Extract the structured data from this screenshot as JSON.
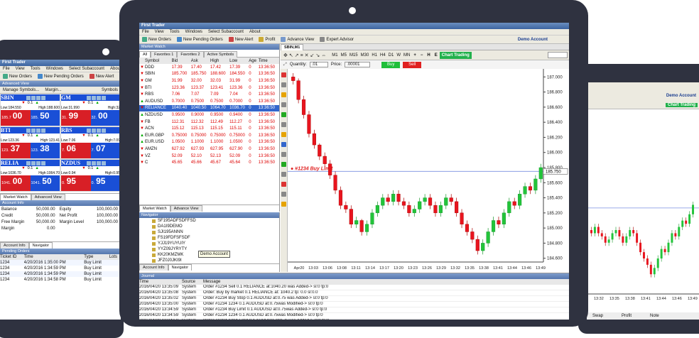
{
  "app": {
    "title": "First Trader",
    "menu": [
      "File",
      "View",
      "Tools",
      "Windows",
      "Select Subaccount",
      "About"
    ],
    "toolbar": {
      "new_orders": "New Orders",
      "new_pending_orders": "New Pending Orders",
      "new_alert": "New Alert",
      "profit": "Profit",
      "advance_view": "Advance View",
      "expert_advisor": "Expert Advisor"
    },
    "account_label": "Demo Account"
  },
  "market_watch": {
    "header": "Market Watch",
    "tabs": [
      "All",
      "Favorites 1",
      "Favorites 2",
      "Active Symbols"
    ],
    "columns": [
      "Symbol",
      "Bid",
      "Ask",
      "High",
      "Low",
      "Age",
      "Time"
    ],
    "rows": [
      {
        "dir": "down",
        "symbol": "DDD",
        "bid": "17.39",
        "ask": "17.40",
        "high": "17.42",
        "low": "17.39",
        "age": "0",
        "time": "13:36:50"
      },
      {
        "dir": "down",
        "symbol": "SBIN",
        "bid": "185.700",
        "ask": "185.750",
        "high": "188.600",
        "low": "184.550",
        "age": "0",
        "time": "13:36:50"
      },
      {
        "dir": "down",
        "symbol": "GM",
        "bid": "31.99",
        "ask": "32.00",
        "high": "32.03",
        "low": "31.99",
        "age": "0",
        "time": "13:36:50"
      },
      {
        "dir": "down",
        "symbol": "BTI",
        "bid": "123.36",
        "ask": "123.37",
        "high": "123.41",
        "low": "123.36",
        "age": "0",
        "time": "13:36:50"
      },
      {
        "dir": "down",
        "symbol": "RBS",
        "bid": "7.06",
        "ask": "7.07",
        "high": "7.09",
        "low": "7.04",
        "age": "0",
        "time": "13:36:50"
      },
      {
        "dir": "up",
        "symbol": "AUDUSD",
        "bid": "0.7000",
        "ask": "0.7500",
        "high": "0.7500",
        "low": "0.7000",
        "age": "0",
        "time": "13:36:50"
      },
      {
        "dir": "down",
        "symbol": "RELIANCE",
        "bid": "1040.40",
        "ask": "1040.50",
        "high": "1064.70",
        "low": "1036.70",
        "age": "0",
        "time": "13:36:50"
      },
      {
        "dir": "up",
        "symbol": "NZDUSD",
        "bid": "0.9500",
        "ask": "0.9000",
        "high": "0.9500",
        "low": "0.9400",
        "age": "0",
        "time": "13:36:50"
      },
      {
        "dir": "down",
        "symbol": "FB",
        "bid": "112.31",
        "ask": "112.32",
        "high": "112.49",
        "low": "112.27",
        "age": "0",
        "time": "13:36:50"
      },
      {
        "dir": "down",
        "symbol": "ACN",
        "bid": "115.12",
        "ask": "115.13",
        "high": "115.15",
        "low": "115.11",
        "age": "0",
        "time": "13:36:50"
      },
      {
        "dir": "up",
        "symbol": "EUR.GBP",
        "bid": "0.75000",
        "ask": "0.75000",
        "high": "0.75000",
        "low": "0.75000",
        "age": "0",
        "time": "13:36:50"
      },
      {
        "dir": "up",
        "symbol": "EUR.USD",
        "bid": "1.0500",
        "ask": "1.1000",
        "high": "1.1000",
        "low": "1.0500",
        "age": "0",
        "time": "13:36:50"
      },
      {
        "dir": "down",
        "symbol": "AMZN",
        "bid": "627.92",
        "ask": "627.93",
        "high": "627.95",
        "low": "627.90",
        "age": "0",
        "time": "13:36:50"
      },
      {
        "dir": "down",
        "symbol": "VZ",
        "bid": "52.09",
        "ask": "52.10",
        "high": "52.13",
        "low": "52.09",
        "age": "0",
        "time": "13:36:50"
      },
      {
        "dir": "down",
        "symbol": "C",
        "bid": "45.65",
        "ask": "45.66",
        "high": "45.67",
        "low": "45.64",
        "age": "0",
        "time": "13:36:50"
      }
    ],
    "bottom_tabs": [
      "Market Watch",
      "Advance View"
    ]
  },
  "navigator": {
    "header": "Navigator",
    "items": [
      "SF195ADFSDFFSD",
      "DA1I9DEMO",
      "SJI195ANNN",
      "FS19FDFSFSDF",
      "YJJ19YUYUIY",
      "YYZ09JYRYTY",
      "KK20KMZMK",
      "JFZ0J0JKI9I"
    ],
    "tooltip": "Demo Account",
    "tabs": [
      "Account Info",
      "Navigator"
    ]
  },
  "chart": {
    "tab": "SBIN,M1",
    "timeframes": [
      "M1",
      "M5",
      "M15",
      "M30",
      "H1",
      "H4",
      "D1",
      "W",
      "MN"
    ],
    "zoom": [
      "+",
      "−",
      "H",
      "E"
    ],
    "chart_trading": "Chart Trading",
    "quantity_label": "Quantity:",
    "quantity_value": ".01",
    "price_label": "Price:",
    "price_value": ".00001",
    "buy": "Buy",
    "sell": "Sell",
    "order_label": "#1234 Buy Limit",
    "price_tag": "185.750"
  },
  "journal": {
    "header": "Journal",
    "columns": [
      "Time",
      "Source",
      "Message"
    ],
    "rows": [
      {
        "time": "2016/04/20 13:35:09",
        "source": "System",
        "message": "Order #1234 Sell 0.1 RELIANCE at:1040.20 was Added-> sl:0 tp:0"
      },
      {
        "time": "2016/04/20 13:35:08",
        "source": "System",
        "message": "Order: Buy by market 0.1 RELIANCE at: 1040.2 tp: 0.0 sl:0.0"
      },
      {
        "time": "2016/04/20 13:35:02",
        "source": "System",
        "message": "Order #1234 Buy Stop 0.1 AUDUSD at:0.75 was Added-> sl:0 tp:0"
      },
      {
        "time": "2016/04/20 13:35:00",
        "source": "System",
        "message": "Order #1234 1234 0.1 AUDUSD at:0.75was Modified-> sl:0 tp:0"
      },
      {
        "time": "2016/04/20 13:34:59",
        "source": "System",
        "message": "Order #1234 Buy Limit 0.1 AUDUSD at:0.75was Added-> sl:0 tp:0"
      },
      {
        "time": "2016/04/20 13:34:59",
        "source": "System",
        "message": "Order #1234 1234 0.1 AUDUSD at:0.75was Modified-> sl:0 tp:0"
      },
      {
        "time": "2016/04/20 13:34:58",
        "source": "System",
        "message": "Order #1234 1234 Limit 0.1 AUDUSD at:0.75was Added-> sl:0 tp:0"
      },
      {
        "time": "2016/04/20 13:34:56",
        "source": "System",
        "message": "Order #1234 1234 0.1 AUDUSD at:0.75was Modified-> sl:0 tp:0"
      }
    ]
  },
  "left_app": {
    "advanced_view": "Advanced View",
    "manage_symbols": "Manage Symbols...",
    "margin": "Margin...",
    "symbols": "Symbols",
    "tiles": [
      {
        "symbol": "SBIN",
        "low": "Low:184.550",
        "high": "High:188.600",
        "qty": "0.1",
        "sell_price": "185.7",
        "sell_big": "00",
        "buy_price": "185.",
        "buy_big": "50",
        "color": "#1a4fd6"
      },
      {
        "symbol": "GM",
        "low": "Low:31.990",
        "high": "High:32",
        "qty": "0.1",
        "sell_price": "31.",
        "sell_big": "99",
        "buy_price": "32.",
        "buy_big": "00",
        "color": "#1a4fd6"
      },
      {
        "symbol": "BTI",
        "low": "Low:123.36",
        "high": "High:123.41",
        "qty": "0.1",
        "sell_price": "123.",
        "sell_big": "37",
        "buy_price": "123.",
        "buy_big": "38",
        "color": "#1a4fd6"
      },
      {
        "symbol": "RBS",
        "low": "Low:7.06",
        "high": "High:7.09",
        "qty": "0.1",
        "sell_price": "7.",
        "sell_big": "06",
        "buy_price": "7.",
        "buy_big": "07",
        "color": "#1a4fd6"
      },
      {
        "symbol": "RELIA",
        "low": "Low:1036.70",
        "high": "High:1064.70",
        "qty": "0.1",
        "sell_price": "1041.",
        "sell_big": "00",
        "buy_price": "1041.",
        "buy_big": "50",
        "color": "#1a4fd6"
      },
      {
        "symbol": "NZDUS",
        "low": "Low:0.94",
        "high": "High:0.95",
        "qty": "0.1",
        "sell_price": "0.",
        "sell_big": "95",
        "buy_price": "0.",
        "buy_big": "95",
        "color": "#1a4fd6"
      }
    ],
    "bottom_tabs": [
      "Market Watch",
      "Advanced View"
    ],
    "account": {
      "header": "Account Info",
      "rows": [
        [
          "Balance",
          "50,000.00",
          "Equity",
          "100,000.00"
        ],
        [
          "Credit",
          "50,000.00",
          "Net Profit",
          "100,000.00"
        ],
        [
          "Free Margin",
          "50,000.00",
          "Margin Level",
          "100,000.00"
        ],
        [
          "Margin",
          "0.00",
          "",
          ""
        ]
      ],
      "tabs": [
        "Account Info",
        "Navigator"
      ]
    },
    "pending": {
      "header": "Pending Orders",
      "columns": [
        "Ticket ID",
        "Time",
        "Type",
        "Lots"
      ],
      "rows": [
        [
          "1234",
          "4/20/2016 1:35:00 PM",
          "Buy Limit",
          ""
        ],
        [
          "1234",
          "4/20/2016 1:34:59 PM",
          "Buy Limit",
          ""
        ],
        [
          "1234",
          "4/20/2016 1:34:59 PM",
          "Buy Limit",
          ""
        ],
        [
          "1234",
          "4/20/2016 1:34:58 PM",
          "Buy Limit",
          ""
        ]
      ]
    }
  },
  "right_app": {
    "account_label": "Demo Account",
    "chart_trading": "Chart Trading",
    "columns": [
      "Swap",
      "Profit",
      "Note"
    ]
  },
  "chart_data": {
    "type": "candlestick",
    "title": "SBIN,M1",
    "x_ticks": [
      "Apr20",
      "13:03",
      "13:06",
      "13:08",
      "13:11",
      "13:14",
      "13:17",
      "13:20",
      "13:23",
      "13:26",
      "13:29",
      "13:32",
      "13:35",
      "13:38",
      "13:41",
      "13:44",
      "13:46",
      "13:49"
    ],
    "y_ticks": [
      "187.000",
      "186.800",
      "186.600",
      "186.400",
      "186.200",
      "186.000",
      "185.800",
      "185.600",
      "185.400",
      "185.200",
      "185.000",
      "184.800",
      "184.600"
    ],
    "ylim": [
      184.55,
      187.05
    ],
    "buy_limit_level": 185.75,
    "candles": [
      [
        187.0,
        186.95,
        187.05,
        186.9
      ],
      [
        186.95,
        186.7,
        186.98,
        186.65
      ],
      [
        186.7,
        186.5,
        186.75,
        186.45
      ],
      [
        186.5,
        186.25,
        186.55,
        186.2
      ],
      [
        186.25,
        186.1,
        186.3,
        186.05
      ],
      [
        186.1,
        185.95,
        186.12,
        185.9
      ],
      [
        185.95,
        185.85,
        186.0,
        185.8
      ],
      [
        185.85,
        185.7,
        185.9,
        185.65
      ],
      [
        185.7,
        185.5,
        185.75,
        185.45
      ],
      [
        185.5,
        185.3,
        185.55,
        185.25
      ],
      [
        185.3,
        185.25,
        185.35,
        185.2
      ],
      [
        185.25,
        185.05,
        185.3,
        185.0
      ],
      [
        185.05,
        185.1,
        185.15,
        185.0
      ],
      [
        185.1,
        184.95,
        185.12,
        184.9
      ],
      [
        184.95,
        185.05,
        185.1,
        184.9
      ],
      [
        185.05,
        185.2,
        185.25,
        185.0
      ],
      [
        185.2,
        185.3,
        185.35,
        185.15
      ],
      [
        185.3,
        185.4,
        185.45,
        185.25
      ],
      [
        185.4,
        185.35,
        185.45,
        185.3
      ],
      [
        185.35,
        185.45,
        185.5,
        185.3
      ],
      [
        185.45,
        185.35,
        185.5,
        185.3
      ],
      [
        185.35,
        185.3,
        185.4,
        185.25
      ],
      [
        185.3,
        185.2,
        185.35,
        185.15
      ],
      [
        185.2,
        185.25,
        185.3,
        185.15
      ],
      [
        185.25,
        185.35,
        185.4,
        185.2
      ],
      [
        185.35,
        185.4,
        185.45,
        185.3
      ],
      [
        185.4,
        185.3,
        185.45,
        185.25
      ],
      [
        185.3,
        185.2,
        185.35,
        185.15
      ],
      [
        185.2,
        185.3,
        185.35,
        185.15
      ],
      [
        185.3,
        185.4,
        185.45,
        185.25
      ],
      [
        185.4,
        185.35,
        185.45,
        185.3
      ],
      [
        185.35,
        185.2,
        185.4,
        185.15
      ],
      [
        185.2,
        185.05,
        185.25,
        185.0
      ],
      [
        185.05,
        184.95,
        185.1,
        184.9
      ],
      [
        184.95,
        184.85,
        185.0,
        184.8
      ],
      [
        184.85,
        184.7,
        184.9,
        184.65
      ],
      [
        184.7,
        184.8,
        184.85,
        184.65
      ],
      [
        184.8,
        184.95,
        185.0,
        184.75
      ],
      [
        184.95,
        185.1,
        185.15,
        184.9
      ],
      [
        185.1,
        185.05,
        185.15,
        185.0
      ],
      [
        185.05,
        185.2,
        185.25,
        185.0
      ],
      [
        185.2,
        185.35,
        185.4,
        185.15
      ],
      [
        185.35,
        185.3,
        185.4,
        185.25
      ],
      [
        185.3,
        185.45,
        185.5,
        185.25
      ],
      [
        185.45,
        185.55,
        185.6,
        185.4
      ],
      [
        185.55,
        185.5,
        185.6,
        185.45
      ],
      [
        185.5,
        185.65,
        185.7,
        185.45
      ],
      [
        185.65,
        185.8,
        185.85,
        185.6
      ]
    ]
  }
}
